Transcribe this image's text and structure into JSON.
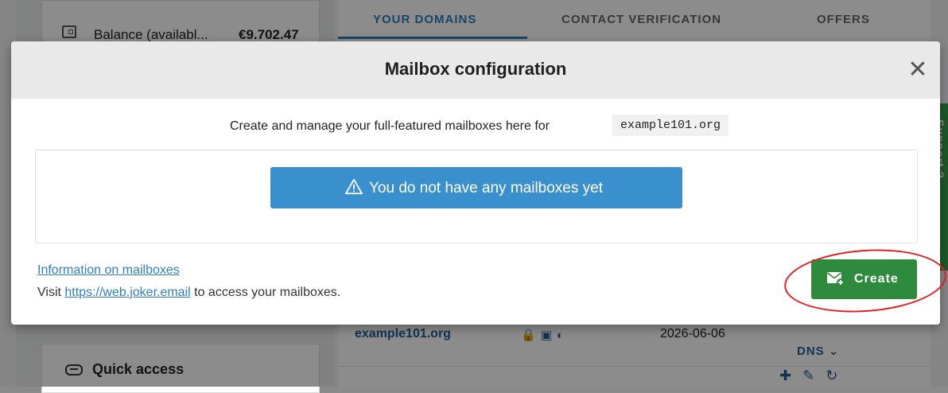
{
  "background": {
    "balance_label": "Balance (availabl...",
    "balance_value": "€9.702.47",
    "quick_access_label": "Quick access",
    "tabs": [
      {
        "label": "YOUR DOMAINS",
        "active": true
      },
      {
        "label": "CONTACT VERIFICATION",
        "active": false
      },
      {
        "label": "OFFERS",
        "active": false
      }
    ],
    "domain_row": {
      "domain": "example101.org",
      "date": "2026-06-06",
      "dns_label": "DNS ⌄"
    },
    "support_tab_label": "Support ?"
  },
  "modal": {
    "title": "Mailbox configuration",
    "close_glyph": "✕",
    "intro_text": "Create and manage your full-featured mailboxes here for",
    "domain": "example101.org",
    "empty_alert": "You do not have any mailboxes yet",
    "info_link": "Information on mailboxes",
    "visit_prefix": "Visit",
    "visit_link": "https://web.joker.email",
    "visit_suffix": "to access your mailboxes.",
    "create_label": "Create"
  },
  "colors": {
    "accent_blue": "#2f7fbd",
    "alert_blue": "#3a90cc",
    "create_green": "#2e8b3d",
    "highlight_red": "#e0201f"
  },
  "icons": [
    "wallet-icon",
    "link-icon",
    "warning-icon",
    "mail-add-icon",
    "close-icon",
    "lock-icon",
    "shield-icon"
  ]
}
